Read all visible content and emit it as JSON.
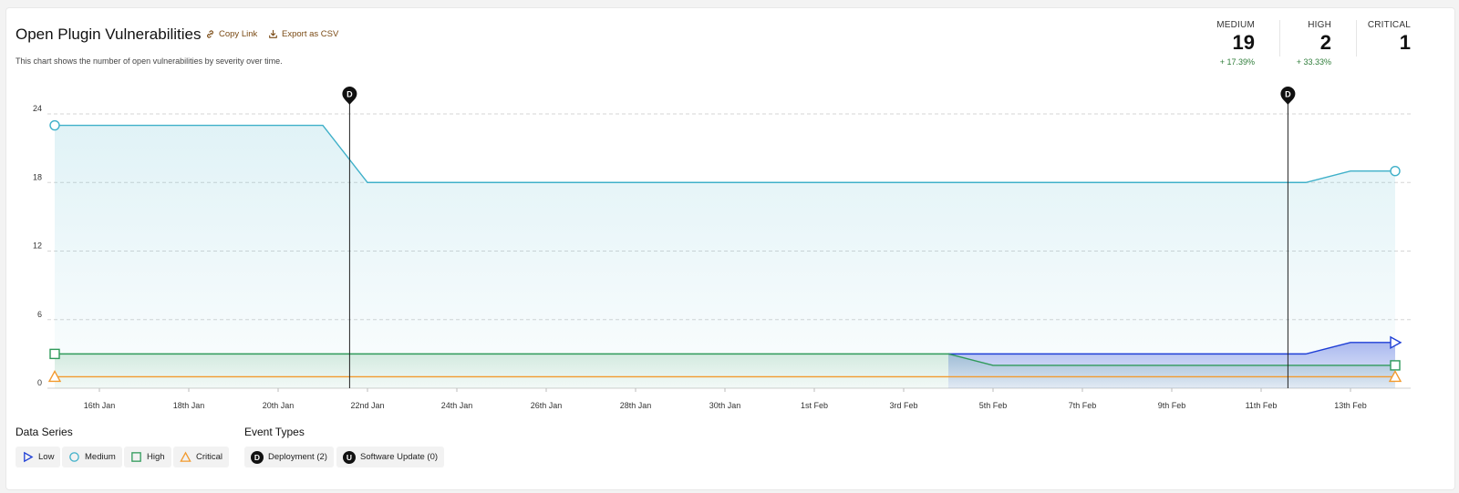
{
  "header": {
    "title": "Open Plugin Vulnerabilities",
    "copy_link": "Copy Link",
    "export_csv": "Export as CSV",
    "subtitle": "This chart shows the number of open vulnerabilities by severity over time."
  },
  "stats": [
    {
      "label": "MEDIUM",
      "value": "19",
      "change": "+ 17.39%"
    },
    {
      "label": "HIGH",
      "value": "2",
      "change": "+ 33.33%"
    },
    {
      "label": "CRITICAL",
      "value": "1",
      "change": ""
    }
  ],
  "chart_data": {
    "type": "line",
    "y_ticks": [
      "0",
      "6",
      "12",
      "18",
      "24"
    ],
    "ylim": [
      0,
      24
    ],
    "x_ticks": [
      "16th Jan",
      "18th Jan",
      "20th Jan",
      "22nd Jan",
      "24th Jan",
      "26th Jan",
      "28th Jan",
      "30th Jan",
      "1st Feb",
      "3rd Feb",
      "5th Feb",
      "7th Feb",
      "9th Feb",
      "11th Feb",
      "13th Feb"
    ],
    "x_range": [
      "2024-01-15",
      "2024-02-14"
    ],
    "series": [
      {
        "name": "Medium",
        "color": "#3fb0c9",
        "marker": "circle",
        "points": [
          [
            "2024-01-15",
            23
          ],
          [
            "2024-01-21",
            23
          ],
          [
            "2024-01-22",
            18
          ],
          [
            "2024-02-12",
            18
          ],
          [
            "2024-02-13",
            19
          ],
          [
            "2024-02-14",
            19
          ]
        ]
      },
      {
        "name": "Low",
        "color": "#1f3fd6",
        "marker": "triangle-right",
        "points": [
          [
            "2024-02-04",
            3
          ],
          [
            "2024-02-12",
            3
          ],
          [
            "2024-02-13",
            4
          ],
          [
            "2024-02-14",
            4
          ]
        ]
      },
      {
        "name": "High",
        "color": "#2f9a5a",
        "marker": "square",
        "points": [
          [
            "2024-01-15",
            3
          ],
          [
            "2024-02-04",
            3
          ],
          [
            "2024-02-05",
            2
          ],
          [
            "2024-02-14",
            2
          ]
        ]
      },
      {
        "name": "Critical",
        "color": "#f29a2e",
        "marker": "triangle",
        "points": [
          [
            "2024-01-15",
            1
          ],
          [
            "2024-02-14",
            1
          ]
        ]
      }
    ],
    "events": [
      {
        "type": "D",
        "date": "2024-01-21",
        "time_fraction": 0.6
      },
      {
        "type": "D",
        "date": "2024-02-11",
        "time_fraction": 0.6
      }
    ],
    "grid": "horizontal dashed"
  },
  "legend": {
    "data_series_title": "Data Series",
    "event_types_title": "Event Types",
    "series_items": [
      "Low",
      "Medium",
      "High",
      "Critical"
    ],
    "event_items": [
      {
        "badge": "D",
        "label": "Deployment (2)"
      },
      {
        "badge": "U",
        "label": "Software Update (0)"
      }
    ]
  }
}
